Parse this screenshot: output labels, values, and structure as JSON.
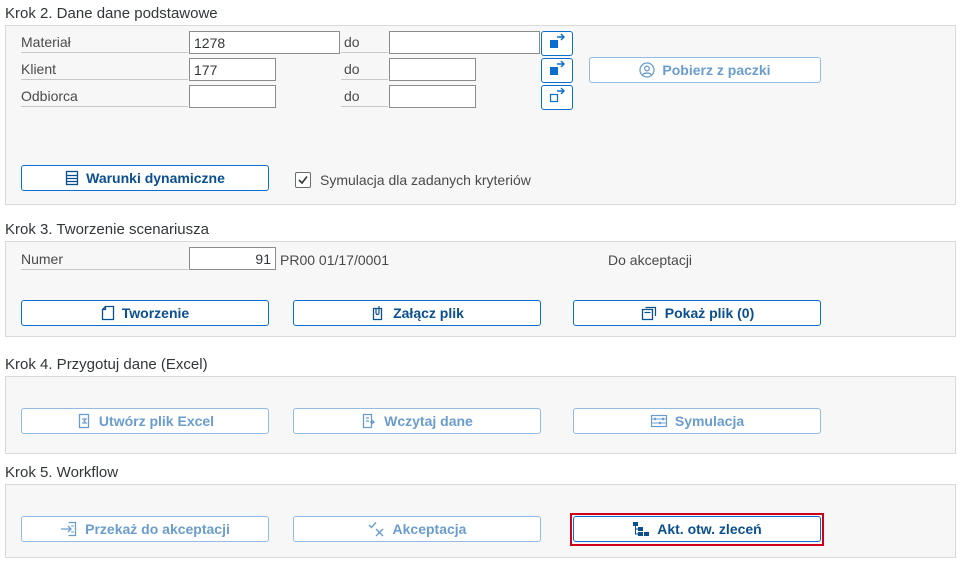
{
  "step2": {
    "title": "Krok 2. Dane dane podstawowe",
    "rows": [
      {
        "label": "Materiał",
        "from": "1278",
        "to_label": "do",
        "to": ""
      },
      {
        "label": "Klient",
        "from": "177",
        "to_label": "do",
        "to": ""
      },
      {
        "label": "Odbiorca",
        "from": "",
        "to_label": "do",
        "to": ""
      }
    ],
    "fetch_button": "Pobierz z paczki",
    "dynamic_button": "Warunki dynamiczne",
    "simulation_checkbox": {
      "label": "Symulacja dla zadanych kryteriów",
      "checked": true
    }
  },
  "step3": {
    "title": "Krok 3. Tworzenie scenariusza",
    "number_label": "Numer",
    "number_value": "91",
    "number_code": "PR00 01/17/0001",
    "status": "Do akceptacji",
    "create_button": "Tworzenie",
    "attach_button": "Załącz plik",
    "show_file_button": "Pokaż plik (0)"
  },
  "step4": {
    "title": "Krok 4. Przygotuj dane (Excel)",
    "excel_button": "Utwórz plik Excel",
    "load_button": "Wczytaj dane",
    "simulation_button": "Symulacja"
  },
  "step5": {
    "title": "Krok 5. Workflow",
    "forward_button": "Przekaż do akceptacji",
    "accept_button": "Akceptacja",
    "refresh_button": "Akt. otw. zleceń"
  },
  "colors": {
    "accent": "#0a6ed1",
    "highlight": "#d0021b",
    "panel_bg": "#f7f7f7"
  }
}
